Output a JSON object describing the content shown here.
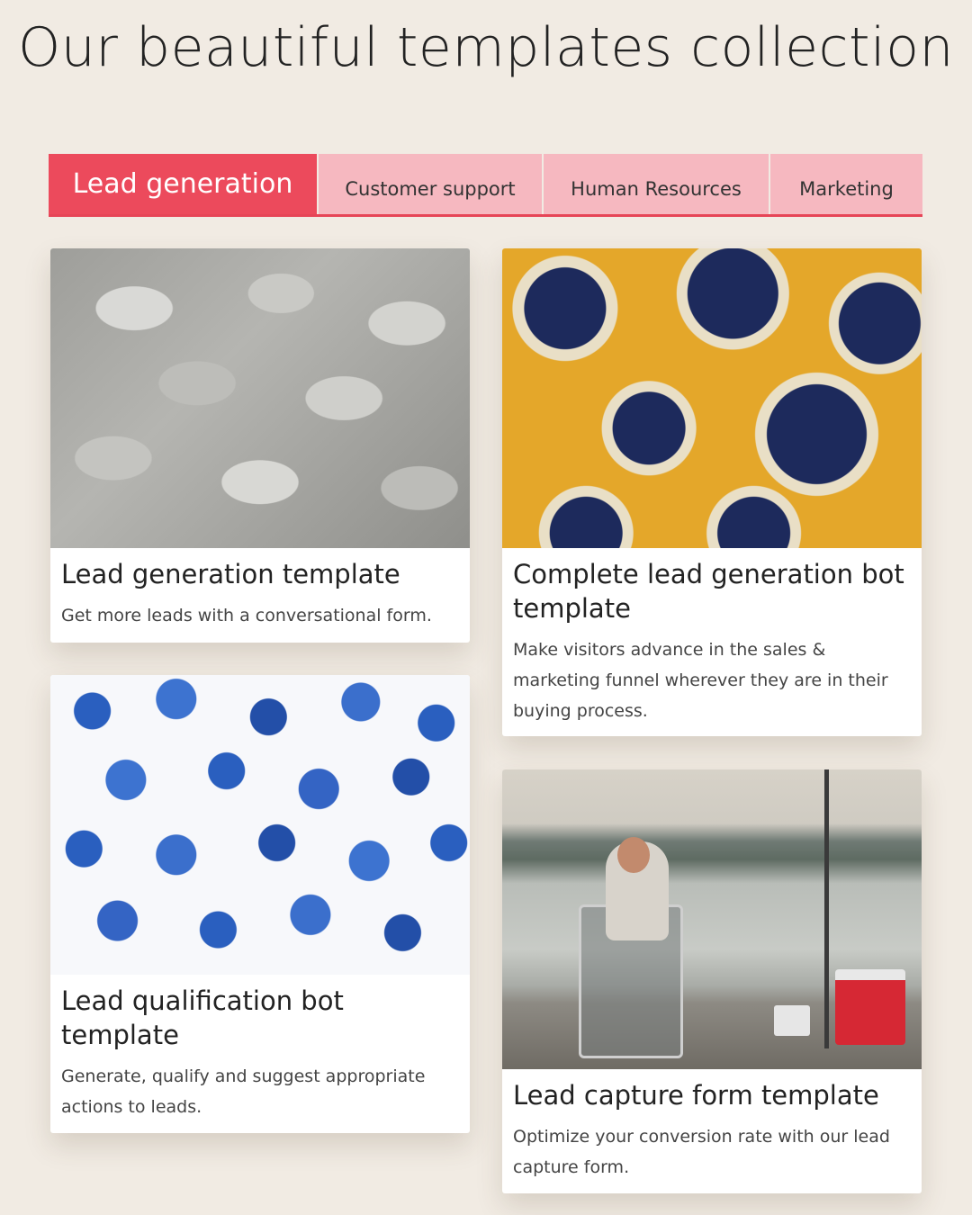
{
  "page": {
    "title": "Our beautiful templates collection"
  },
  "tabs": [
    {
      "label": "Lead generation",
      "active": true
    },
    {
      "label": "Customer support",
      "active": false
    },
    {
      "label": "Human Resources",
      "active": false
    },
    {
      "label": "Marketing",
      "active": false
    }
  ],
  "colors": {
    "background": "#f1ebe3",
    "accent": "#ec4a5c",
    "tab_inactive": "#f6b8c0"
  },
  "cards": [
    {
      "title": "Lead generation template",
      "description": "Get more leads with a conversational form.",
      "image": "fish-photo"
    },
    {
      "title": "Complete lead generation bot template",
      "description": "Make visitors advance in the sales & marketing funnel wherever they are in their buying process.",
      "image": "lemon-pattern"
    },
    {
      "title": "Lead qualification bot template",
      "description": "Generate, qualify and suggest appropriate actions to leads.",
      "image": "blueberry-pattern"
    },
    {
      "title": "Lead capture form template",
      "description": "Optimize your conversion rate with our lead capture form.",
      "image": "fishing-photo"
    }
  ]
}
